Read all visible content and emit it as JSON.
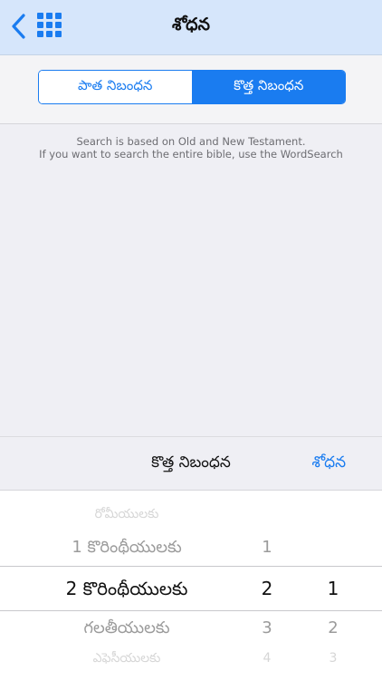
{
  "colors": {
    "accent": "#1a7cf0",
    "navbar_bg": "#d6e6fb",
    "background": "#efeff4"
  },
  "navbar": {
    "back_icon": "chevron-left-icon",
    "menu_icon": "grid-icon",
    "title": "శోధన"
  },
  "segmented": {
    "items": [
      "పాత నిబంధన",
      "కొత్త నిబంధన"
    ],
    "selected": "కొత్త నిబంధన"
  },
  "info": {
    "line1": "Search is based on Old and New Testament.",
    "line2": "If you want to search the entire bible, use the WordSearch"
  },
  "toolbar": {
    "label": "కొత్త నిబంధన",
    "search_button": "శోధన"
  },
  "picker": {
    "books": [
      "రోమీయులకు",
      "1 కొరింథీయులకు",
      "2 కొరింథీయులకు",
      "గలతీయులకు",
      "ఎఫెసీయులకు"
    ],
    "chapters": [
      "",
      "1",
      "2",
      "3",
      "4"
    ],
    "verses": [
      "",
      "",
      "1",
      "2",
      "3"
    ],
    "selected": {
      "book": "2 కొరింథీయులకు",
      "chapter": "2",
      "verse": "1"
    }
  }
}
